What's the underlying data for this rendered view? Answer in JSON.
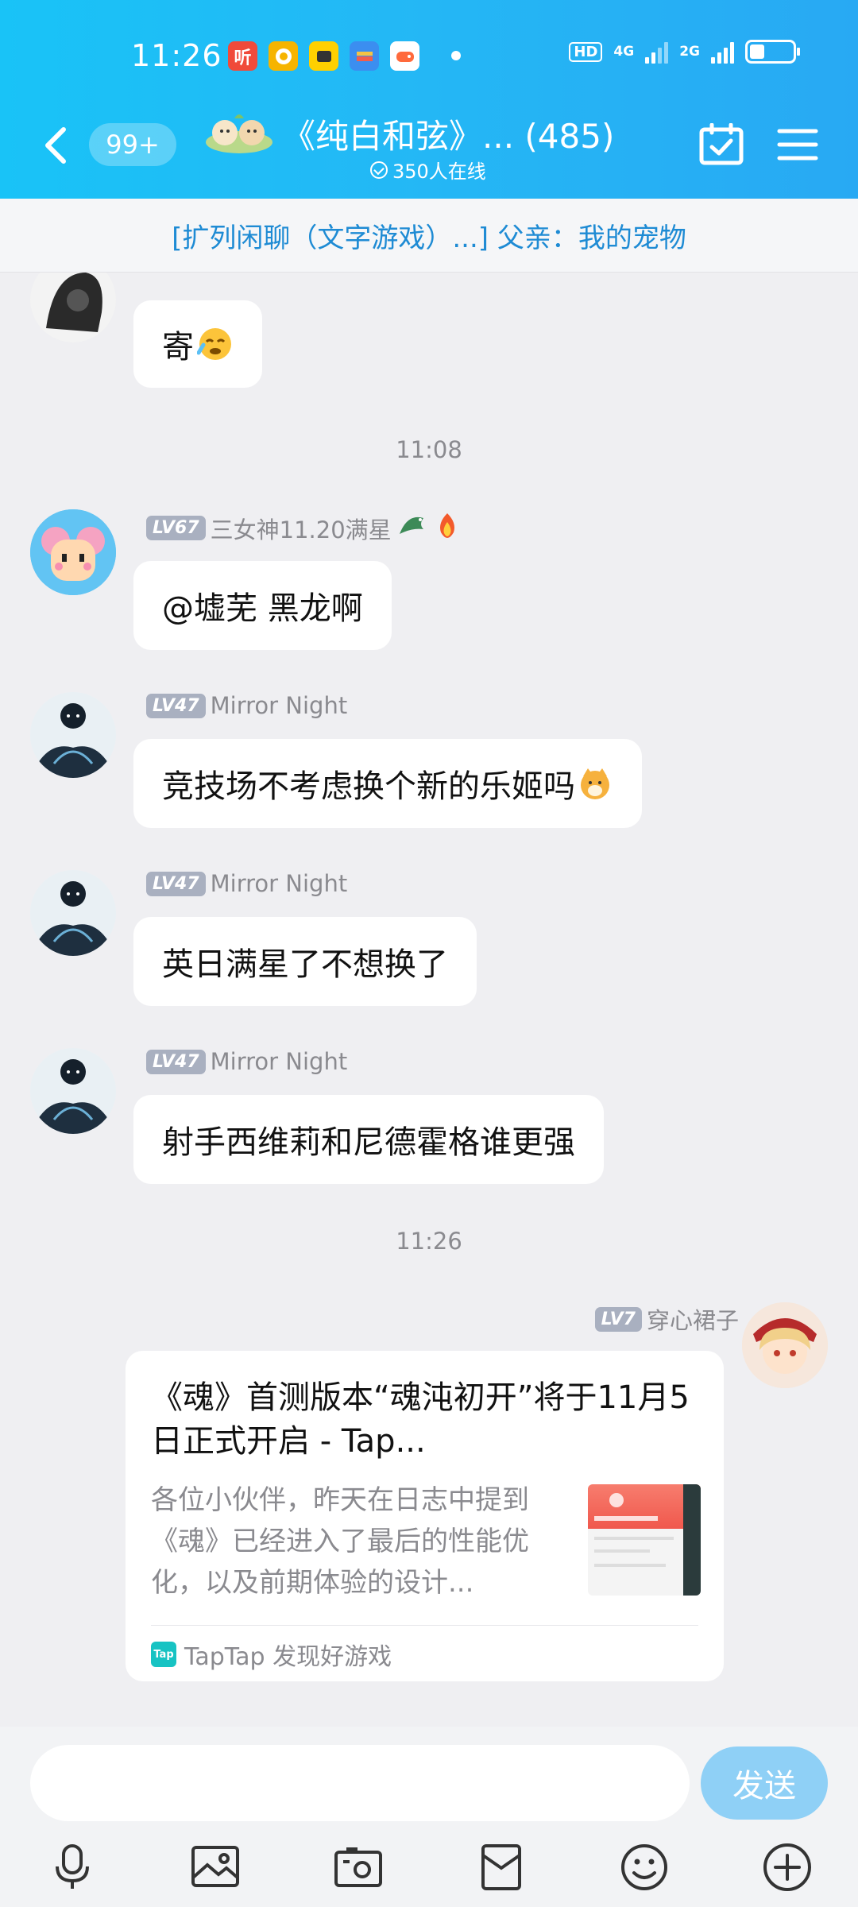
{
  "status_bar": {
    "time": "11:26",
    "app_icons": [
      {
        "name": "ting-app-icon",
        "label": "听",
        "color": "#f04a3a"
      },
      {
        "name": "kuaishou-app-icon",
        "label": "",
        "color": "#f6b400"
      },
      {
        "name": "xianyu-app-icon",
        "label": "",
        "color": "#ffd000"
      },
      {
        "name": "wallet-app-icon",
        "label": "",
        "color": "#3b8ef0"
      },
      {
        "name": "game-app-icon",
        "label": "",
        "color": "#ff6a3c"
      }
    ],
    "network": "HD",
    "net_4g": "4G",
    "net_2g": "2G"
  },
  "header": {
    "unread_badge": "99+",
    "title": "《纯白和弦》... (485)",
    "online": "350人在线"
  },
  "notice": {
    "text": "[扩列闲聊（文字游戏）...] 父亲：我的宠物"
  },
  "messages": [
    {
      "sender_partial": "",
      "text": "寄"
    },
    {
      "timestamp": "11:08"
    },
    {
      "level": "LV67",
      "sender": "三女神11.20满星",
      "text": "@墟芜 黑龙啊"
    },
    {
      "level": "LV47",
      "sender": "Mirror Night",
      "text": "竞技场不考虑换个新的乐姬吗"
    },
    {
      "level": "LV47",
      "sender": "Mirror Night",
      "text": "英日满星了不想换了"
    },
    {
      "level": "LV47",
      "sender": "Mirror Night",
      "text": "射手西维莉和尼德霍格谁更强"
    },
    {
      "timestamp": "11:26"
    },
    {
      "level": "LV7",
      "sender": "穿心裙子",
      "card": {
        "title": "《魂》首测版本“魂沌初开”将于11月5日正式开启 - Tap...",
        "description": "各位小伙伴，昨天在日志中提到《魂》已经进入了最后的性能优化，以及前期体验的设计...",
        "source": "TapTap 发现好游戏",
        "source_logo": "Tap"
      }
    }
  ],
  "input": {
    "placeholder": "",
    "send_label": "发送"
  },
  "toolbar_icons": [
    "microphone-icon",
    "image-icon",
    "camera-icon",
    "red-packet-icon",
    "emoji-icon",
    "plus-icon"
  ]
}
